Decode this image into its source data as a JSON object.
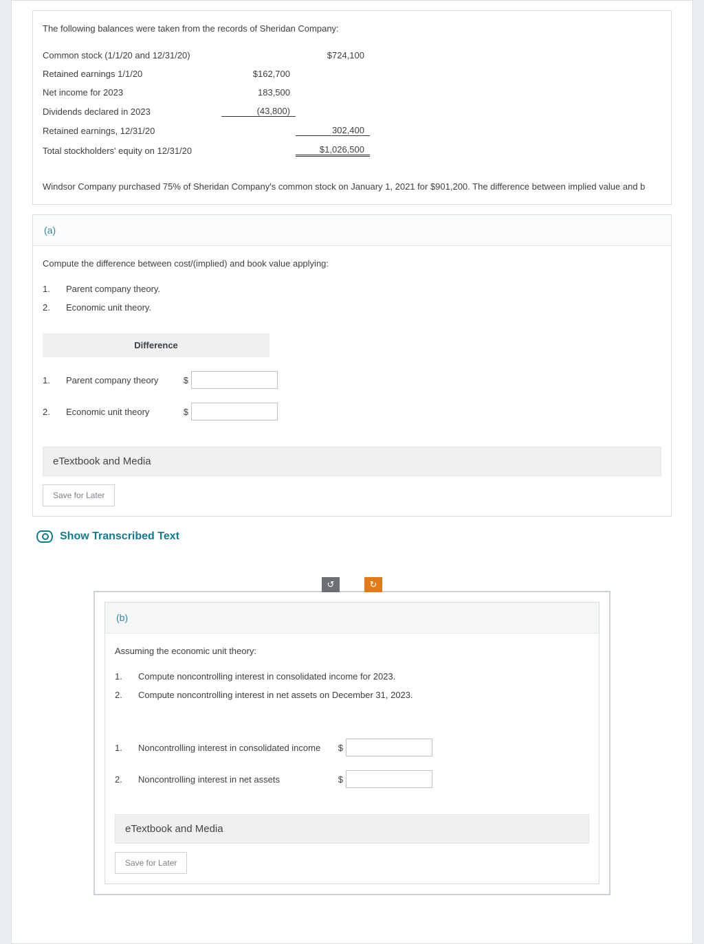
{
  "top": {
    "intro": "The following balances were taken from the records of Sheridan Company:",
    "rows": {
      "common_stock_label": "Common stock (1/1/20 and 12/31/20)",
      "common_stock_val": "$724,100",
      "re_begin_label": "Retained earnings 1/1/20",
      "re_begin_val": "$162,700",
      "net_income_label": "Net income for 2023",
      "net_income_val": "183,500",
      "div_label": "Dividends declared in 2023",
      "div_val": "(43,800)",
      "re_end_label": "Retained earnings, 12/31/20",
      "re_end_val": "302,400",
      "total_label": "Total stockholders' equity on 12/31/20",
      "total_val": "$1,026,500"
    },
    "after": "Windsor Company purchased 75% of Sheridan Company's common stock on January 1, 2021 for $901,200. The difference between implied value and b"
  },
  "partA": {
    "tag": "(a)",
    "prompt": "Compute the difference between cost/(implied) and book value applying:",
    "items": {
      "i1": "Parent company theory.",
      "i2": "Economic unit theory."
    },
    "table": {
      "header": "Difference",
      "r1": "Parent company theory",
      "r2": "Economic unit theory"
    }
  },
  "partB": {
    "tag": "(b)",
    "prompt": "Assuming the economic unit theory:",
    "items": {
      "i1": "Compute noncontrolling interest in consolidated income for 2023.",
      "i2": "Compute noncontrolling interest in net assets on December 31, 2023."
    },
    "rows": {
      "r1": "Noncontrolling interest in consolidated income",
      "r2": "Noncontrolling interest in net assets"
    }
  },
  "common": {
    "etext": "eTextbook and Media",
    "save": "Save for Later",
    "dollar": "$",
    "n1": "1.",
    "n2": "2.",
    "show": "Show Transcribed Text",
    "undo": "↺",
    "redo": "↻"
  }
}
